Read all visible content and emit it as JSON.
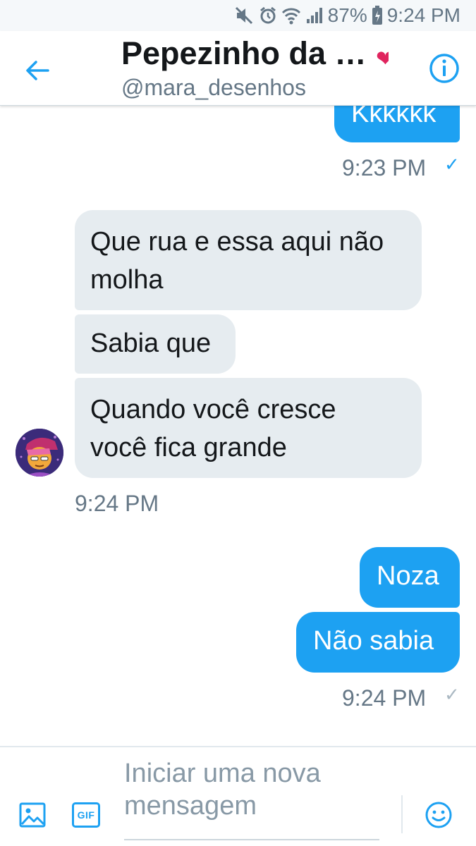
{
  "status_bar": {
    "battery": "87%",
    "time": "9:24 PM"
  },
  "header": {
    "title": "Pepezinho da …",
    "handle": "@mara_desenhos"
  },
  "messages": {
    "sent_top": {
      "text": "Kkkkkk",
      "time": "9:23 PM"
    },
    "received": {
      "bubbles": [
        "Que rua e essa aqui não",
        "molha",
        "Sabia que",
        "Quando você cresce",
        "você fica grande"
      ],
      "time": "9:24 PM"
    },
    "sent_bottom": {
      "bubbles": [
        "Noza",
        "Não sabia"
      ],
      "time": "9:24 PM"
    }
  },
  "composer": {
    "placeholder_line1": "Iniciar uma nova",
    "placeholder_line2": "mensagem",
    "gif_label": "GIF"
  },
  "colors": {
    "accent": "#1da1f2",
    "received_bubble": "#e6ecf0",
    "secondary_text": "#657786"
  }
}
